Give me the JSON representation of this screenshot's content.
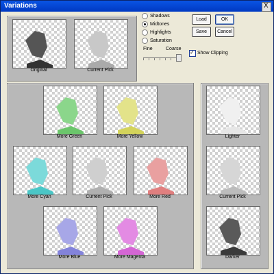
{
  "window": {
    "title": "Variations",
    "close_label": "X"
  },
  "top": {
    "original_caption": "Original",
    "current_caption": "Current Pick"
  },
  "modes": [
    {
      "label": "Shadows",
      "selected": false
    },
    {
      "label": "Midtones",
      "selected": true
    },
    {
      "label": "Highlights",
      "selected": false
    },
    {
      "label": "Saturation",
      "selected": false
    }
  ],
  "buttons": {
    "load": "Load",
    "ok": "OK",
    "save": "Save",
    "cancel": "Cancel"
  },
  "fine_coarse": {
    "fine": "Fine",
    "coarse": "Coarse",
    "position_fraction": 0.9
  },
  "show_clipping": {
    "label": "Show Clipping",
    "checked": true
  },
  "grid": {
    "captions": [
      "More Green",
      "More Yellow",
      "More Cyan",
      "Current Pick",
      "More Red",
      "More Blue",
      "More Magenta"
    ],
    "tints": [
      "#8bd68b",
      "#e3e38a",
      "#7cdada",
      "#cfcfcf",
      "#e9a0a0",
      "#a7a7e7",
      "#e38be3"
    ]
  },
  "right": {
    "captions": [
      "Lighter",
      "Current Pick",
      "Darker"
    ],
    "tints": [
      "#f0f0f0",
      "#d6d6d6",
      "#5a5a5a"
    ]
  },
  "colors": {
    "title_bar": "#0a54e3",
    "dialog_bg": "#ece9d8",
    "panel_bg": "#b8b8b8"
  }
}
